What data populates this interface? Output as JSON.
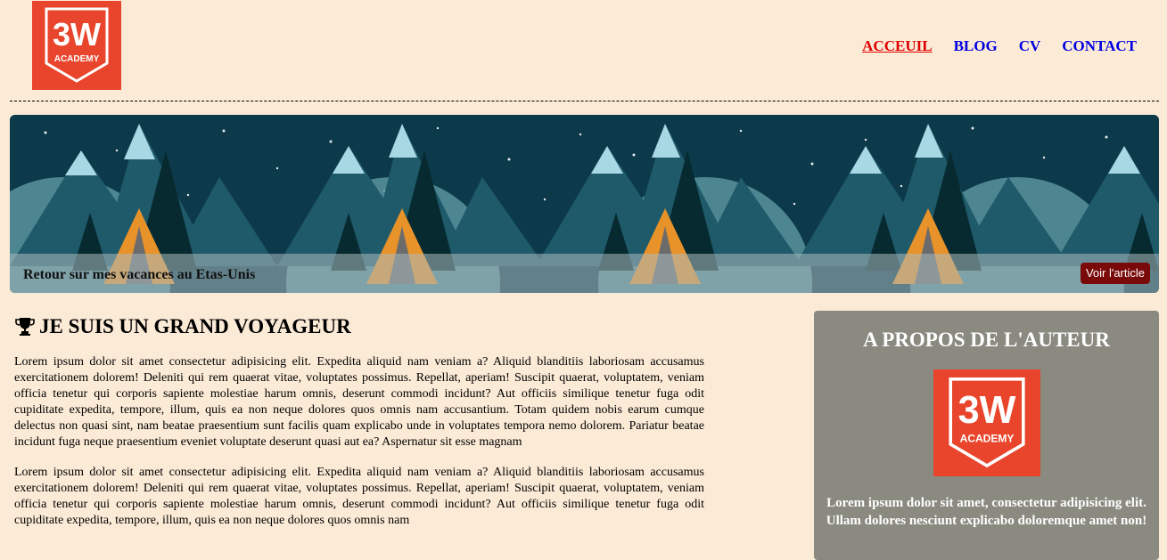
{
  "logo": {
    "line1": "3W",
    "line2": "ACADEMY"
  },
  "nav": {
    "items": [
      {
        "label": "ACCEUIL",
        "active": true
      },
      {
        "label": "BLOG",
        "active": false
      },
      {
        "label": "CV",
        "active": false
      },
      {
        "label": "CONTACT",
        "active": false
      }
    ]
  },
  "banner": {
    "title": "Retour sur mes vacances au Etas-Unis",
    "button_label": "Voir l'article"
  },
  "main": {
    "heading": "JE SUIS UN GRAND VOYAGEUR",
    "icon": "trophy-icon",
    "paragraphs": [
      "Lorem ipsum dolor sit amet consectetur adipisicing elit. Expedita aliquid nam veniam a? Aliquid blanditiis laboriosam accusamus exercitationem dolorem! Deleniti qui rem quaerat vitae, voluptates possimus. Repellat, aperiam! Suscipit quaerat, voluptatem, veniam officia tenetur qui corporis sapiente molestiae harum omnis, deserunt commodi incidunt? Aut officiis similique tenetur fuga odit cupiditate expedita, tempore, illum, quis ea non neque dolores quos omnis nam accusantium. Totam quidem nobis earum cumque delectus non quasi sint, nam beatae praesentium sunt facilis quam explicabo unde in voluptates tempora nemo dolorem. Pariatur beatae incidunt fuga neque praesentium eveniet voluptate deserunt quasi aut ea? Aspernatur sit esse magnam",
      "Lorem ipsum dolor sit amet consectetur adipisicing elit. Expedita aliquid nam veniam a? Aliquid blanditiis laboriosam accusamus exercitationem dolorem! Deleniti qui rem quaerat vitae, voluptates possimus. Repellat, aperiam! Suscipit quaerat, voluptatem, veniam officia tenetur qui corporis sapiente molestiae harum omnis, deserunt commodi incidunt? Aut officiis similique tenetur fuga odit cupiditate expedita, tempore, illum, quis ea non neque dolores quos omnis nam"
    ]
  },
  "sidebar": {
    "heading": "A PROPOS DE L'AUTEUR",
    "text": "Lorem ipsum dolor sit amet, consectetur adipisicing elit. Ullam dolores nesciunt explicabo doloremque amet non!"
  },
  "colors": {
    "background": "#fbead6",
    "brand": "#e8452c",
    "nav_link": "#0000e0",
    "nav_active": "#e00000",
    "button": "#7a0a0a",
    "sidebar_bg": "#8a8a80"
  }
}
